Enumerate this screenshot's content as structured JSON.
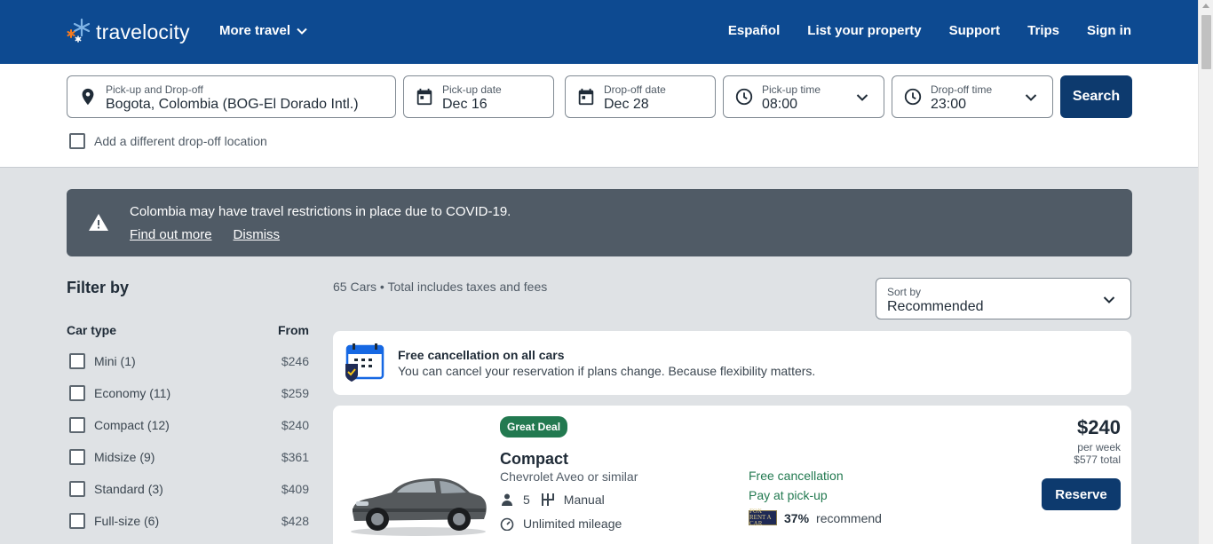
{
  "header": {
    "logo_text": "travelocity",
    "more_travel": "More travel",
    "nav": [
      "Español",
      "List your property",
      "Support",
      "Trips",
      "Sign in"
    ]
  },
  "search": {
    "location_label": "Pick-up and Drop-off",
    "location_value": "Bogota, Colombia (BOG-El Dorado Intl.)",
    "pickup_date_label": "Pick-up date",
    "pickup_date_value": "Dec 16",
    "dropoff_date_label": "Drop-off date",
    "dropoff_date_value": "Dec 28",
    "pickup_time_label": "Pick-up time",
    "pickup_time_value": "08:00",
    "dropoff_time_label": "Drop-off time",
    "dropoff_time_value": "23:00",
    "search_button": "Search",
    "different_dropoff": "Add a different drop-off location"
  },
  "alert": {
    "message": "Colombia may have travel restrictions in place due to COVID-19.",
    "find_out_more": "Find out more",
    "dismiss": "Dismiss"
  },
  "filters": {
    "title": "Filter by",
    "car_type_heading": "Car type",
    "from_heading": "From",
    "items": [
      {
        "label": "Mini (1)",
        "price": "$246"
      },
      {
        "label": "Economy (11)",
        "price": "$259"
      },
      {
        "label": "Compact (12)",
        "price": "$240"
      },
      {
        "label": "Midsize (9)",
        "price": "$361"
      },
      {
        "label": "Standard (3)",
        "price": "$409"
      },
      {
        "label": "Full-size (6)",
        "price": "$428"
      }
    ]
  },
  "results": {
    "count_text": "65 Cars • Total includes taxes and fees",
    "sort_label": "Sort by",
    "sort_value": "Recommended"
  },
  "free_cancellation": {
    "title": "Free cancellation on all cars",
    "subtitle": "You can cancel your reservation if plans change. Because flexibility matters."
  },
  "car": {
    "badge": "Great Deal",
    "class": "Compact",
    "model": "Chevrolet Aveo or similar",
    "seats": "5",
    "transmission": "Manual",
    "mileage": "Unlimited mileage",
    "perk1": "Free cancellation",
    "perk2": "Pay at pick-up",
    "vendor_logo_text": "FOX RENT A CAR",
    "recommend_pct": "37%",
    "recommend_text": "recommend",
    "price": "$240",
    "per": "per week",
    "total": "$577 total",
    "reserve": "Reserve"
  },
  "colors": {
    "header_bg": "#0d4a91",
    "primary_button": "#0d3a6e",
    "deal_green": "#227950",
    "alert_bg": "#505b66"
  }
}
